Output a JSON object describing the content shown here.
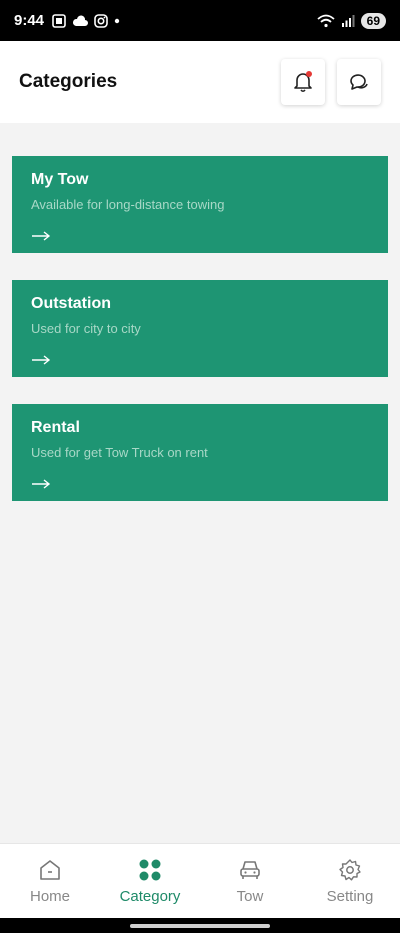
{
  "status": {
    "time": "9:44",
    "battery": "69"
  },
  "header": {
    "title": "Categories"
  },
  "categories": [
    {
      "title": "My Tow",
      "desc": "Available for long-distance towing"
    },
    {
      "title": "Outstation",
      "desc": "Used for  city to city"
    },
    {
      "title": "Rental",
      "desc": "Used for get Tow Truck on rent"
    }
  ],
  "nav": {
    "items": [
      {
        "label": "Home",
        "icon": "home-icon"
      },
      {
        "label": "Category",
        "icon": "grid-icon"
      },
      {
        "label": "Tow",
        "icon": "car-icon"
      },
      {
        "label": "Setting",
        "icon": "gear-icon"
      }
    ],
    "active": "Category"
  },
  "colors": {
    "accent": "#1e9573",
    "background": "#f3f3f3",
    "notification": "#e53935"
  }
}
